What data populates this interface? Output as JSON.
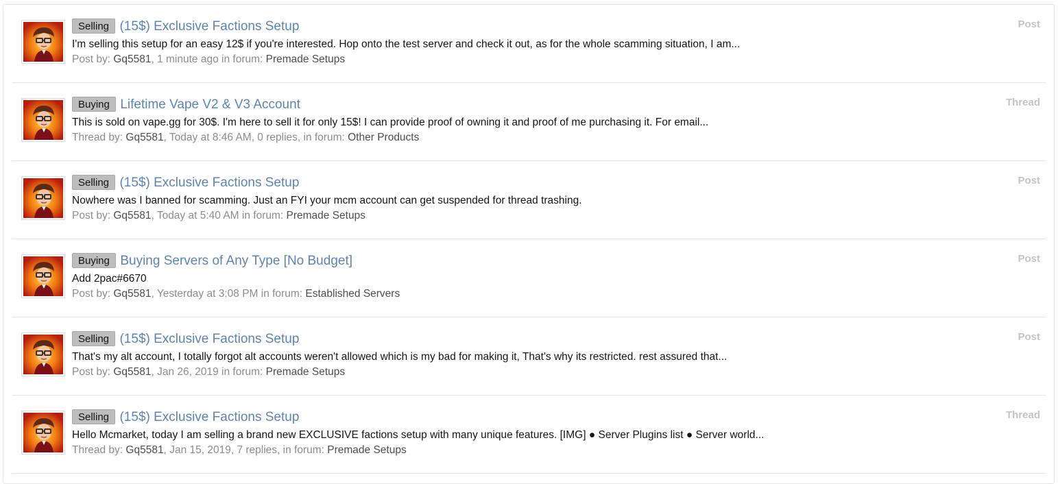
{
  "results": [
    {
      "prefix": "Selling",
      "title": "(15$) Exclusive Factions Setup",
      "snippet": "I'm selling this setup for an easy 12$ if you're interested. Hop onto the test server and check it out, as for the whole scamming situation, I am...",
      "meta_prefix": "Post by:",
      "author": "Gq5581",
      "meta_middle": ", 1 minute ago in forum:",
      "forum": "Premade Setups",
      "type": "Post"
    },
    {
      "prefix": "Buying",
      "title": "Lifetime Vape V2 & V3 Account",
      "snippet": "This is sold on vape.gg for 30$. I'm here to sell it for only 15$! I can provide proof of owning it and proof of me purchasing it. For email...",
      "meta_prefix": "Thread by:",
      "author": "Gq5581",
      "meta_middle": ", Today at 8:46 AM, 0 replies, in forum:",
      "forum": "Other Products",
      "type": "Thread"
    },
    {
      "prefix": "Selling",
      "title": "(15$) Exclusive Factions Setup",
      "snippet": "Nowhere was I banned for scamming. Just an FYI your mcm account can get suspended for thread trashing.",
      "meta_prefix": "Post by:",
      "author": "Gq5581",
      "meta_middle": ", Today at 5:40 AM in forum:",
      "forum": "Premade Setups",
      "type": "Post"
    },
    {
      "prefix": "Buying",
      "title": "Buying Servers of Any Type [No Budget]",
      "snippet": "Add 2pac#6670",
      "meta_prefix": "Post by:",
      "author": "Gq5581",
      "meta_middle": ", Yesterday at 3:08 PM in forum:",
      "forum": "Established Servers",
      "type": "Post"
    },
    {
      "prefix": "Selling",
      "title": "(15$) Exclusive Factions Setup",
      "snippet": "That's my alt account, I totally forgot alt accounts weren't allowed which is my bad for making it, That's why its restricted. rest assured that...",
      "meta_prefix": "Post by:",
      "author": "Gq5581",
      "meta_middle": ", Jan 26, 2019 in forum:",
      "forum": "Premade Setups",
      "type": "Post"
    },
    {
      "prefix": "Selling",
      "title": "(15$) Exclusive Factions Setup",
      "snippet": "Hello Mcmarket, today I am selling a brand new EXCLUSIVE factions setup with many unique features. [IMG] ● Server Plugins list ● Server world...",
      "meta_prefix": "Thread by:",
      "author": "Gq5581",
      "meta_middle": ", Jan 15, 2019, 7 replies, in forum:",
      "forum": "Premade Setups",
      "type": "Thread"
    }
  ],
  "colors": {
    "title_link": "#5b84b6",
    "prefix_bg": "#bdbdbd",
    "meta_text": "#8c8c8c",
    "type_label": "#c4c4c4"
  },
  "icons": {
    "avatar": "user-avatar-icon"
  }
}
